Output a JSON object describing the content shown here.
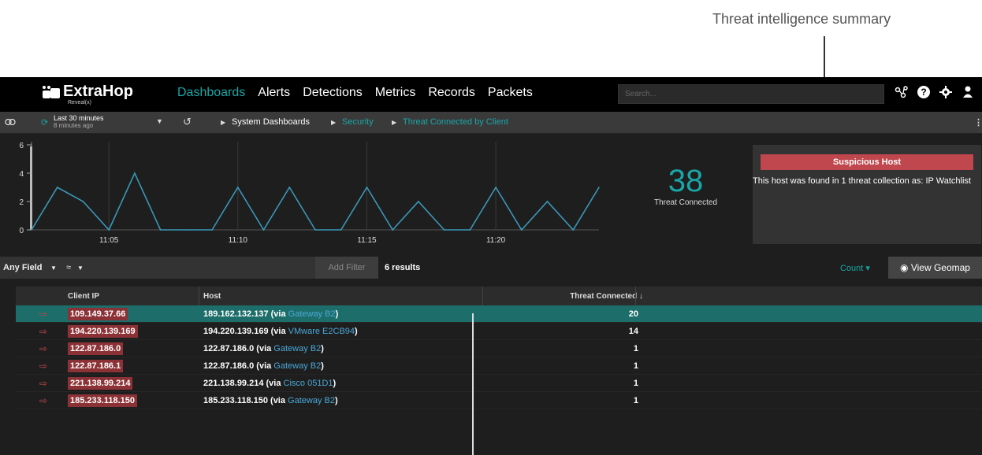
{
  "callout": {
    "title": "Threat intelligence summary"
  },
  "app": {
    "logo": {
      "name": "ExtraHop",
      "sub": "Reveal(x)"
    },
    "nav": [
      "Dashboards",
      "Alerts",
      "Detections",
      "Metrics",
      "Records",
      "Packets"
    ],
    "search_placeholder": "Search...",
    "icons": [
      "network-icon",
      "help-icon",
      "gear-icon",
      "user-icon"
    ],
    "timerange": {
      "label": "Last 30 minutes",
      "sub": "8 minutes ago"
    },
    "breadcrumb": [
      "System Dashboards",
      "Security",
      "Threat Connected by Client"
    ]
  },
  "chart_data": {
    "type": "line",
    "x": [
      "11:02",
      "11:03",
      "11:04",
      "11:05",
      "11:06",
      "11:07",
      "11:08",
      "11:09",
      "11:10",
      "11:11",
      "11:12",
      "11:13",
      "11:14",
      "11:15",
      "11:16",
      "11:17",
      "11:18",
      "11:19",
      "11:20",
      "11:21",
      "11:22",
      "11:23",
      "11:24"
    ],
    "series": [
      {
        "values": [
          0,
          3,
          2,
          0,
          4,
          0,
          0,
          0,
          3,
          0,
          3,
          0,
          0,
          3,
          0,
          2,
          0,
          0,
          3,
          0,
          2,
          0,
          3
        ]
      }
    ],
    "yticks": [
      0,
      2,
      4,
      6
    ],
    "xticks": [
      "11:05",
      "11:10",
      "11:15",
      "11:20"
    ],
    "ylim": [
      0,
      6
    ],
    "grid": "vertical",
    "color": "#3a97b8"
  },
  "kpi": {
    "value": "38",
    "label": "Threat Connected"
  },
  "threat": {
    "badge": "Suspicious Host",
    "text": "This host was found in 1 threat collection as: IP Watchlist"
  },
  "filter": {
    "field": "Any Field",
    "op": "≈",
    "add": "Add Filter",
    "results": "6 results",
    "count": "Count",
    "geomap": "View Geomap"
  },
  "table": {
    "headers": [
      "Client IP",
      "Host",
      "Threat Connected ↓"
    ],
    "rows": [
      {
        "ip": "109.149.37.66",
        "host": "189.162.132.137 (via ",
        "via": "Gateway B2",
        "value": "20"
      },
      {
        "ip": "194.220.139.169",
        "host": "194.220.139.169 (via ",
        "via": "VMware E2CB94",
        "value": "14"
      },
      {
        "ip": "122.87.186.0",
        "host": "122.87.186.0 (via ",
        "via": "Gateway B2",
        "value": "1"
      },
      {
        "ip": "122.87.186.1",
        "host": "122.87.186.0 (via ",
        "via": "Gateway B2",
        "value": "1"
      },
      {
        "ip": "221.138.99.214",
        "host": "221.138.99.214 (via ",
        "via": "Cisco 051D1",
        "value": "1"
      },
      {
        "ip": "185.233.118.150",
        "host": "185.233.118.150 (via ",
        "via": "Gateway B2",
        "value": "1"
      }
    ]
  }
}
